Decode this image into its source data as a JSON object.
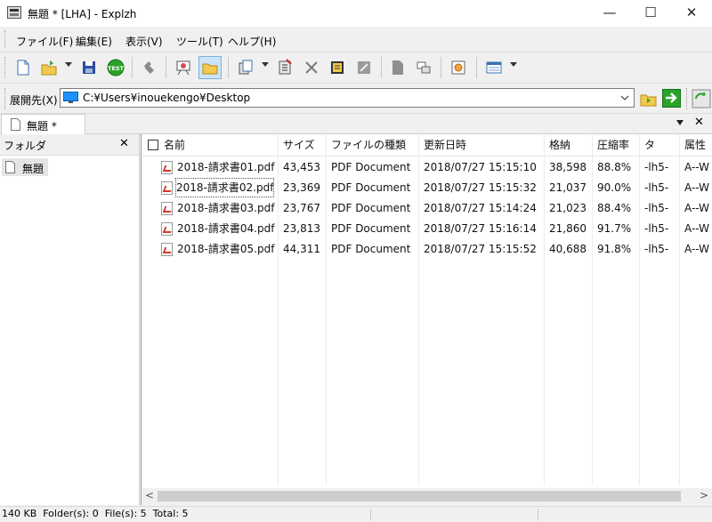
{
  "window": {
    "title": "無題 * [LHA] - Explzh",
    "minimize": "—",
    "maximize": "☐",
    "close": "✕"
  },
  "menu": [
    "ファイル(F)",
    "編集(E)",
    "表示(V)",
    "ツール(T)",
    "ヘルプ(H)"
  ],
  "toolbar": {
    "icons": [
      "new-archive-icon",
      "open-archive-icon",
      "save-icon",
      "test-icon",
      "extract-icon",
      "view-icon",
      "folder-open-icon",
      "copy-icon",
      "delete-file-icon",
      "delete-icon",
      "properties-icon",
      "convert-icon",
      "page-icon",
      "split-icon",
      "settings-icon",
      "view-mode-icon"
    ],
    "test_label": "TEST"
  },
  "pathbar": {
    "label": "展開先(X)",
    "path": "C:¥Users¥inouekengo¥Desktop"
  },
  "tab": {
    "label": "無題 *"
  },
  "folder_pane": {
    "title": "フォルダ",
    "close": "✕",
    "items": [
      "無題"
    ]
  },
  "file_list": {
    "columns": [
      "名前",
      "サイズ",
      "ファイルの種類",
      "更新日時",
      "格納",
      "圧縮率",
      "タ",
      "属性"
    ],
    "rows": [
      [
        "2018-請求書01.pdf",
        "43,453",
        "PDF Document",
        "2018/07/27 15:15:10",
        "38,598",
        "88.8%",
        "-lh5-",
        "A--W"
      ],
      [
        "2018-請求書02.pdf",
        "23,369",
        "PDF Document",
        "2018/07/27 15:15:32",
        "21,037",
        "90.0%",
        "-lh5-",
        "A--W"
      ],
      [
        "2018-請求書03.pdf",
        "23,767",
        "PDF Document",
        "2018/07/27 15:14:24",
        "21,023",
        "88.4%",
        "-lh5-",
        "A--W"
      ],
      [
        "2018-請求書04.pdf",
        "23,813",
        "PDF Document",
        "2018/07/27 15:16:14",
        "21,860",
        "91.7%",
        "-lh5-",
        "A--W"
      ],
      [
        "2018-請求書05.pdf",
        "44,311",
        "PDF Document",
        "2018/07/27 15:15:52",
        "40,688",
        "91.8%",
        "-lh5-",
        "A--W"
      ]
    ]
  },
  "scrollbar": {
    "left": "<",
    "right": ">"
  },
  "status": {
    "text": "140 KB  Folder(s): 0  File(s): 5  Total: 5"
  }
}
